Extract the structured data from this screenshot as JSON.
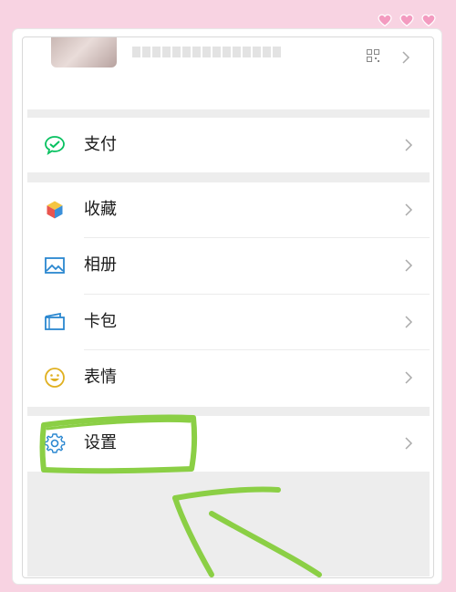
{
  "profile": {
    "qr_icon": "qr-code-icon",
    "chevron_icon": "chevron-right-icon"
  },
  "menu": {
    "pay": {
      "label": "支付",
      "icon": "wechat-pay-icon",
      "color": "#07c160"
    },
    "favorites": {
      "label": "收藏",
      "icon": "cube-icon"
    },
    "album": {
      "label": "相册",
      "icon": "image-icon",
      "color": "#2a87d0"
    },
    "cards": {
      "label": "卡包",
      "icon": "wallet-icon",
      "color": "#2a87d0"
    },
    "stickers": {
      "label": "表情",
      "icon": "smiley-icon",
      "color": "#e0b020"
    },
    "settings": {
      "label": "设置",
      "icon": "gear-icon",
      "color": "#2a87d0"
    }
  },
  "annotation": {
    "color": "#8bcf45"
  },
  "colors": {
    "background": "#f8d3e2",
    "heart": "#f39bc0",
    "divider": "#ededed"
  }
}
